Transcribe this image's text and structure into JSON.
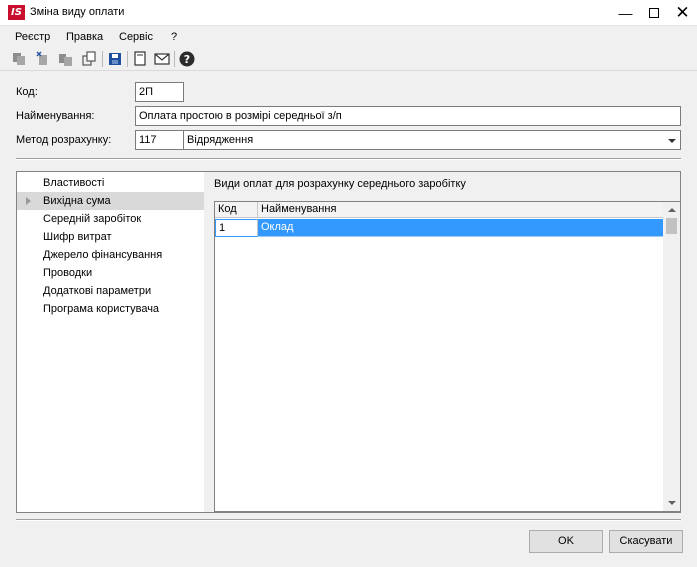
{
  "window": {
    "logo_text": "IS",
    "title": "Зміна виду оплати",
    "minimize_glyph": "—",
    "close_glyph": "✕"
  },
  "menu": [
    "Реєстр",
    "Правка",
    "Сервіс",
    "?"
  ],
  "toolbar": {
    "icons": [
      "copy-icon",
      "new-icon",
      "paste-icon",
      "duplicate-icon",
      "save-icon",
      "properties-icon",
      "mail-icon",
      "help-icon"
    ]
  },
  "form": {
    "code_label": "Код:",
    "code_value": "2П",
    "name_label": "Найменування:",
    "name_value": "Оплата простою в розмірі середньої з/п",
    "method_label": "Метод розрахунку:",
    "method_code": "117",
    "method_value": "Відрядження"
  },
  "nav": {
    "items": [
      "Властивості",
      "Вихідна сума",
      "Середній заробіток",
      "Шифр витрат",
      "Джерело фінансування",
      "Проводки",
      "Додаткові параметри",
      "Програма користувача"
    ],
    "selected": "Вихідна сума"
  },
  "content": {
    "title": "Види оплат для розрахунку середнього заробітку",
    "columns": [
      "Код",
      "Найменування"
    ],
    "rows": [
      {
        "code": "1",
        "name": "Оклад"
      }
    ]
  },
  "buttons": {
    "ok": "OK",
    "cancel": "Скасувати"
  },
  "colors": {
    "selection": "#3399ff",
    "logo": "#c8102e"
  }
}
